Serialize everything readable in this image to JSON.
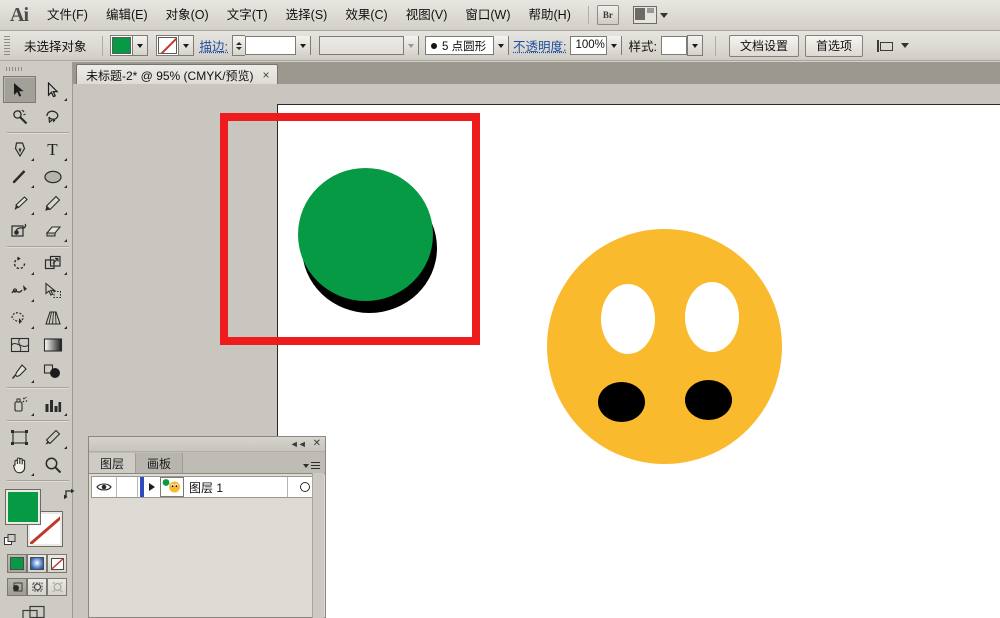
{
  "app": {
    "name": "Adobe Illustrator",
    "logo": "Ai"
  },
  "menubar": {
    "items": [
      {
        "label": "文件(F)",
        "name": "menu-file"
      },
      {
        "label": "编辑(E)",
        "name": "menu-edit"
      },
      {
        "label": "对象(O)",
        "name": "menu-object"
      },
      {
        "label": "文字(T)",
        "name": "menu-type"
      },
      {
        "label": "选择(S)",
        "name": "menu-select"
      },
      {
        "label": "效果(C)",
        "name": "menu-effect"
      },
      {
        "label": "视图(V)",
        "name": "menu-view"
      },
      {
        "label": "窗口(W)",
        "name": "menu-window"
      },
      {
        "label": "帮助(H)",
        "name": "menu-help"
      }
    ],
    "bridge_label": "Br",
    "arrange_icon": "arrange-documents-icon"
  },
  "controlbar": {
    "selection_status": "未选择对象",
    "fill_color": "#079a45",
    "stroke_color": "none",
    "stroke_label": "描边:",
    "stroke_weight_value": "",
    "brush_definition_value": "",
    "variable_width_profile_value": "",
    "stroke_style_label": "5 点圆形",
    "opacity_label": "不透明度:",
    "opacity_value": "100%",
    "style_label": "样式:",
    "style_value": "",
    "document_setup_button": "文档设置",
    "preferences_button": "首选项",
    "align_icon": "align-to-icon"
  },
  "tabs": {
    "documents": [
      {
        "title": "未标题-2* @ 95% (CMYK/预览)",
        "close": "×",
        "active": true
      }
    ]
  },
  "toolbar": {
    "tools": [
      {
        "name": "selection-tool",
        "active": true,
        "has_flyout": false
      },
      {
        "name": "direct-selection-tool",
        "active": false,
        "has_flyout": true
      },
      {
        "name": "magic-wand-tool",
        "active": false,
        "has_flyout": false
      },
      {
        "name": "lasso-tool",
        "active": false,
        "has_flyout": false
      },
      {
        "name": "pen-tool",
        "active": false,
        "has_flyout": true
      },
      {
        "name": "type-tool",
        "active": false,
        "has_flyout": true
      },
      {
        "name": "line-segment-tool",
        "active": false,
        "has_flyout": true
      },
      {
        "name": "ellipse-tool",
        "active": false,
        "has_flyout": true
      },
      {
        "name": "paintbrush-tool",
        "active": false,
        "has_flyout": true
      },
      {
        "name": "pencil-tool",
        "active": false,
        "has_flyout": true
      },
      {
        "name": "blob-brush-tool",
        "active": false,
        "has_flyout": false
      },
      {
        "name": "eraser-tool",
        "active": false,
        "has_flyout": true
      },
      {
        "name": "rotate-tool",
        "active": false,
        "has_flyout": true
      },
      {
        "name": "scale-tool",
        "active": false,
        "has_flyout": true
      },
      {
        "name": "width-tool",
        "active": false,
        "has_flyout": true
      },
      {
        "name": "free-transform-tool",
        "active": false,
        "has_flyout": false
      },
      {
        "name": "shape-builder-tool",
        "active": false,
        "has_flyout": true
      },
      {
        "name": "perspective-grid-tool",
        "active": false,
        "has_flyout": true
      },
      {
        "name": "mesh-tool",
        "active": false,
        "has_flyout": false
      },
      {
        "name": "gradient-tool",
        "active": false,
        "has_flyout": false
      },
      {
        "name": "eyedropper-tool",
        "active": false,
        "has_flyout": true
      },
      {
        "name": "blend-tool",
        "active": false,
        "has_flyout": true
      },
      {
        "name": "symbol-sprayer-tool",
        "active": false,
        "has_flyout": true
      },
      {
        "name": "column-graph-tool",
        "active": false,
        "has_flyout": true
      },
      {
        "name": "artboard-tool",
        "active": false,
        "has_flyout": false
      },
      {
        "name": "slice-tool",
        "active": false,
        "has_flyout": true
      },
      {
        "name": "hand-tool",
        "active": false,
        "has_flyout": true
      },
      {
        "name": "zoom-tool",
        "active": false,
        "has_flyout": false
      }
    ],
    "fill_color": "#079a45",
    "stroke_color": "#ffffff",
    "stroke_is_none": true,
    "fill_stroke_modes": [
      {
        "name": "color-mode-button",
        "selected": true
      },
      {
        "name": "gradient-mode-button",
        "selected": false
      },
      {
        "name": "none-mode-button",
        "selected": false
      }
    ],
    "draw_modes": [
      {
        "name": "draw-normal-button",
        "selected": true
      },
      {
        "name": "draw-behind-button",
        "selected": false
      },
      {
        "name": "draw-inside-button",
        "selected": false
      }
    ],
    "screen_mode": "change-screen-mode-button"
  },
  "canvas": {
    "artboard_background": "#ffffff",
    "pasteboard_background": "#c9c6bf",
    "selection_rect_color": "#ee1c1c",
    "shapes": [
      {
        "name": "green-circle",
        "fill": "#079a45"
      },
      {
        "name": "green-circle-shadow",
        "fill": "#000000"
      },
      {
        "name": "smiley-face",
        "fill": "#f9ba2e"
      },
      {
        "name": "eye-white-left",
        "fill": "#ffffff"
      },
      {
        "name": "eye-white-right",
        "fill": "#ffffff"
      },
      {
        "name": "pupil-left",
        "fill": "#000000"
      },
      {
        "name": "pupil-right",
        "fill": "#000000"
      }
    ]
  },
  "layers_panel": {
    "collapse_icon": "◄◄",
    "close_icon": "✕",
    "tabs": [
      {
        "label": "图层",
        "active": true,
        "name": "tab-layers"
      },
      {
        "label": "画板",
        "active": false,
        "name": "tab-artboards"
      }
    ],
    "rows": [
      {
        "name": "图层 1",
        "visible": true,
        "locked": false,
        "selected": true,
        "color": "#2f4bbf"
      }
    ]
  }
}
